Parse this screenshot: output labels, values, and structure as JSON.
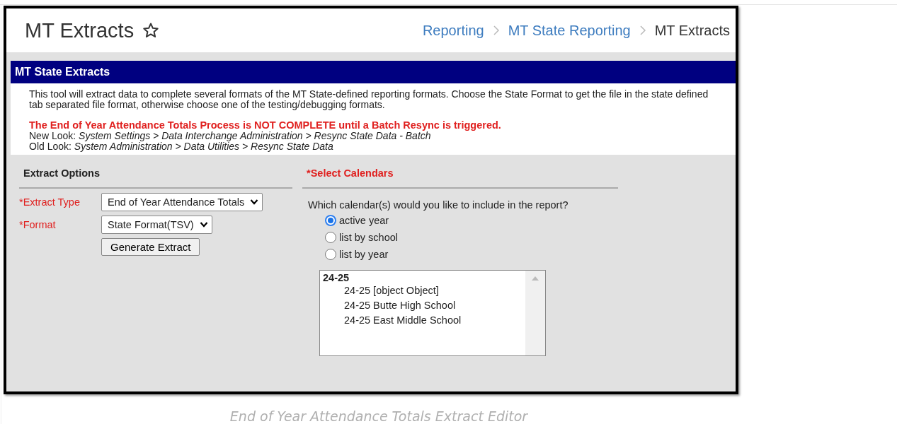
{
  "page": {
    "title": "MT Extracts",
    "breadcrumbs": [
      {
        "label": "Reporting",
        "kind": "link"
      },
      {
        "label": "MT State Reporting",
        "kind": "link"
      },
      {
        "label": "MT Extracts",
        "kind": "current"
      }
    ]
  },
  "panel": {
    "title": "MT State Extracts",
    "description": "This tool will extract data to complete several formats of the MT State-defined reporting formats. Choose the State Format to get the file in the state defined tab separated file format, otherwise choose one of the testing/debugging formats.",
    "warning": "The End of Year Attendance Totals Process is NOT COMPLETE until a Batch Resync is triggered.",
    "paths": [
      {
        "label": "New Look:",
        "path": "System Settings > Data Interchange Administration > Resync State Data - Batch"
      },
      {
        "label": "Old Look:",
        "path": "System Administration > Data Utilities > Resync State Data"
      }
    ]
  },
  "extract_options": {
    "heading": "Extract Options",
    "required": false,
    "fields": [
      {
        "label": "*Extract Type",
        "required": true,
        "value": "End of Year Attendance Totals"
      },
      {
        "label": "*Format",
        "required": true,
        "value": "State Format(TSV)"
      }
    ],
    "button": "Generate Extract"
  },
  "select_calendars": {
    "heading": "*Select Calendars",
    "required": true,
    "question": "Which calendar(s) would you like to include in the report?",
    "options": [
      {
        "label": "active year",
        "selected": true
      },
      {
        "label": "list by school",
        "selected": false
      },
      {
        "label": "list by year",
        "selected": false
      }
    ],
    "calendar_list": [
      {
        "label": "24-25",
        "children": [
          {
            "label": "24-25 [object Object]"
          },
          {
            "label": "24-25 Butte High School"
          },
          {
            "label": "24-25 East Middle School"
          }
        ]
      }
    ]
  },
  "caption": "End of Year Attendance Totals Extract Editor"
}
